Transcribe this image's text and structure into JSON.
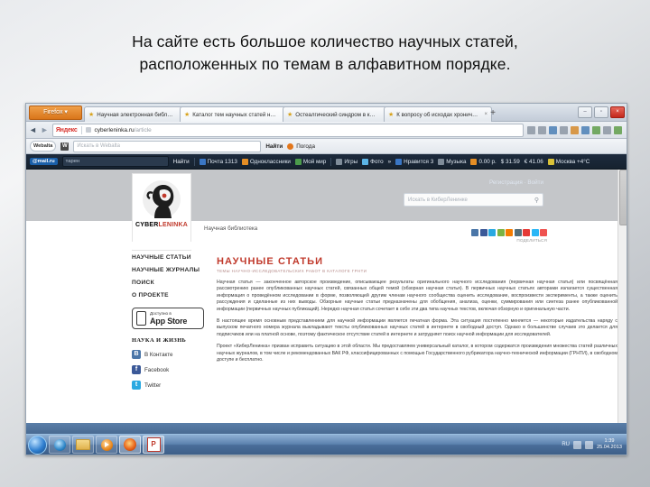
{
  "slide": {
    "caption_line1": "На сайте есть большое количество научных статей,",
    "caption_line2": "расположенных по темам в алфавитном порядке."
  },
  "browser": {
    "app_button": "Firefox ▾",
    "tabs": [
      {
        "title": "Научная электронная библиотека К...",
        "close": "×"
      },
      {
        "title": "Каталог тем научных статей на осн...",
        "close": "×"
      },
      {
        "title": "Остеалгический синдром в клиник...",
        "close": "×"
      },
      {
        "title": "К вопросу об исходах хронической ...",
        "close": "×"
      }
    ],
    "new_tab": "+",
    "window_buttons": {
      "minimize": "–",
      "maximize": "▫",
      "close": "×"
    },
    "nav": {
      "back": "◄",
      "forward": "►"
    },
    "address": {
      "provider_logo": "Яндекс",
      "url_main": "cyberleninka.ru",
      "url_path": "/article"
    }
  },
  "webalta_toolbar": {
    "logo": "Webalta",
    "box_letter": "W",
    "search_placeholder": "Искать в Webalta",
    "find_label": "Найти",
    "weather_label": "Погода"
  },
  "mail_toolbar": {
    "logo": "@mail.ru",
    "search_value": "тарен",
    "find_label": "Найти",
    "items": [
      "Почта 1313",
      "Одноклассники",
      "Мой мир",
      "Игры",
      "Фото"
    ],
    "overflow": "»",
    "status": [
      "Нравится 3",
      "Музыка",
      "0.00 р.",
      "$ 31.59",
      "€ 41.06",
      "Москва +4°C"
    ]
  },
  "site": {
    "logo_word_1": "CYBER",
    "logo_word_2": "LENINKA",
    "tagline": "Научная библиотека",
    "auth": "Регистрация · Войти",
    "search_placeholder": "Искать в КиберЛенинке",
    "search_icon": "⚲",
    "share_label": "ПОДЕЛИТЬСЯ",
    "nav": [
      "НАУЧНЫЕ СТАТЬИ",
      "НАУЧНЫЕ ЖУРНАЛЫ",
      "ПОИСК",
      "О ПРОЕКТЕ"
    ],
    "appstore": {
      "line1": "Доступно в",
      "line2": "App Store"
    },
    "partner": "НАУКА И ЖИЗНЬ",
    "social": [
      {
        "letter": "В",
        "label": "В Контакте"
      },
      {
        "letter": "f",
        "label": "Facebook"
      },
      {
        "letter": "t",
        "label": "Twitter"
      }
    ],
    "heading": "НАУЧНЫЕ СТАТЬИ",
    "subheading": "ТЕМЫ НАУЧНО-ИССЛЕДОВАТЕЛЬСКИХ РАБОТ В КАТАЛОГЕ ГРНТИ",
    "paragraphs": [
      "Научная статья — законченное авторское произведение, описывающее результаты оригинального научного исследования (первичная научная статья) или посвящённая рассмотрению ранее опубликованных научных статей, связанных общей темой (обзорная научная статья). В первичных научных статьях авторами излагается существенная информация о проведённом исследовании в форме, позволяющей другим членам научного сообщества оценить исследование, воспроизвести эксперименты, а также оценить рассуждения и сделанные из них выводы. Обзорные научные статьи предназначены для обобщения, анализа, оценки, суммирования или синтеза ранее опубликованной информации (первичных научных публикаций). Нередко научная статья сочетает в себе эти два типа научных текстов, включая обзорную и оригинальную части.",
      "В настоящее время основным представлением для научной информации является печатная форма. Эта ситуация постепенно меняется — некоторые издательства наряду с выпуском печатного номера журнала выкладывают тексты опубликованных научных статей в интернете в свободный доступ. Однако в большинстве случаев это делается для подписчиков или на платной основе, поэтому фактическое отсутствие статей в интернете и затрудняет поиск научной информации для исследователей.",
      "Проект «КиберЛенинка» призван исправить ситуацию в этой области. Мы предоставляем универсальный каталог, в котором содержатся произведения множества статей различных научных журналов, в том числе и рекомендованных ВАК РФ, классифицированных с помощью Государственного рубрикатора научно-технической информации (ГРНТИ), в свободном доступе и бесплатно."
    ]
  },
  "taskbar": {
    "start": "start-orb",
    "buttons": [
      "Internet Explorer",
      "Проводник",
      "Windows Media Player",
      "Mozilla Firefox",
      "Microsoft PowerPoint"
    ],
    "tray_language": "RU",
    "clock_time": "1:39",
    "clock_date": "25.04.2013"
  }
}
